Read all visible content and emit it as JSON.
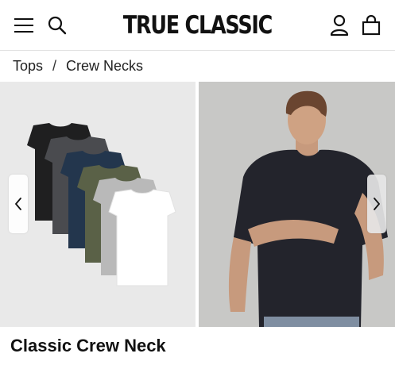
{
  "header": {
    "logo_text": "TRUE CLASSIC",
    "icons": [
      "menu-icon",
      "search-icon",
      "account-icon",
      "bag-icon"
    ]
  },
  "breadcrumb": {
    "items": [
      "Tops",
      "Crew Necks"
    ],
    "separator": "/"
  },
  "gallery": {
    "images": [
      "crew-neck-color-stack",
      "model-wearing-black-crew-neck"
    ],
    "shirt_colors": [
      "#1f1f20",
      "#4a4b4f",
      "#23364d",
      "#5a6147",
      "#b9b9b9",
      "#ffffff"
    ]
  },
  "product": {
    "title": "Classic Crew Neck"
  },
  "colors": {
    "text": "#111111",
    "header_border": "#e2e2e2",
    "left_image_bg": "#e9e9e9",
    "right_image_bg": "#c5c5c3"
  }
}
